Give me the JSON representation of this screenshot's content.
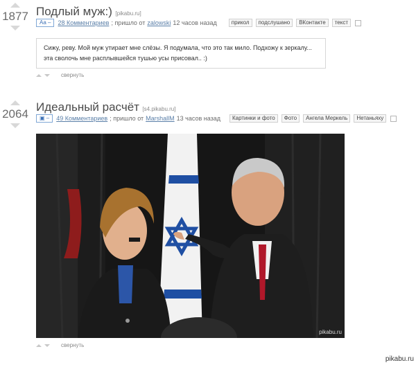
{
  "post1": {
    "rating": "1877",
    "title": "Подлый муж:)",
    "source": "[pikabu.ru]",
    "type_badge": "Aa –",
    "comments": "28 Комментариев",
    "came_from_prefix": "; пришло от",
    "author": "zalowski",
    "time": "12 часов назад",
    "tags": [
      "прикол",
      "подслушано",
      "ВКонтакте",
      "текст"
    ],
    "text": "Сижу, реву. Мой муж утирает мне слёзы. Я подумала, что это так мило. Подхожу к зеркалу... эта сволочь мне расплывшейся тушью усы присовал.. :)",
    "collapse": "свернуть"
  },
  "post2": {
    "rating": "2064",
    "title": "Идеальный расчёт",
    "source": "[s4.pikabu.ru]",
    "type_badge": "▣ –",
    "comments": "49 Комментариев",
    "came_from_prefix": "; пришло от",
    "author": "MarshallM",
    "time": "13 часов назад",
    "tags": [
      "Картинки и фото",
      "Фото",
      "Ангела Меркель",
      "Нетаньяху"
    ],
    "image_watermark": "pikabu.ru",
    "collapse": "свернуть"
  },
  "footer": {
    "watermark": "pikabu.ru"
  },
  "colors": {
    "link": "#5a7fa8",
    "badge": "#3a6fb5",
    "flag_blue": "#1f4fa3",
    "curtain": "#1b1b1b",
    "red_tie": "#b0182a"
  }
}
